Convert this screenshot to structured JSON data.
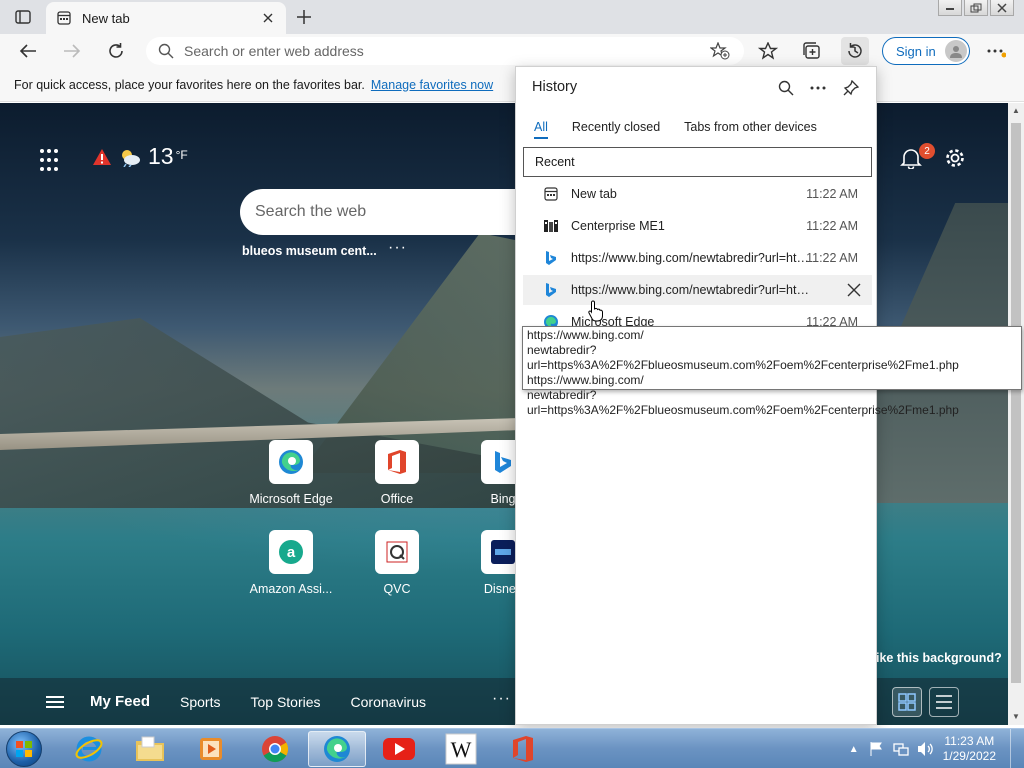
{
  "tab": {
    "title": "New tab"
  },
  "address": {
    "placeholder": "Search or enter web address"
  },
  "toolbar": {
    "signin_label": "Sign in"
  },
  "favorites_bar": {
    "message": "For quick access, place your favorites here on the favorites bar.",
    "link": "Manage favorites now"
  },
  "ntp": {
    "temperature": "13",
    "temp_unit": "°F",
    "search_placeholder": "Search the web",
    "recent_search": "blueos museum cent...",
    "notification_count": "2",
    "tiles": [
      {
        "label": "Microsoft Edge"
      },
      {
        "label": "Office"
      },
      {
        "label": "Bing"
      },
      {
        "label": "Amazon Assi..."
      },
      {
        "label": "QVC"
      },
      {
        "label": "Disney"
      }
    ],
    "background_question": "ike this background?",
    "feed": {
      "items": [
        "My Feed",
        "Sports",
        "Top Stories",
        "Coronavirus"
      ]
    }
  },
  "history": {
    "title": "History",
    "tabs": [
      "All",
      "Recently closed",
      "Tabs from other devices"
    ],
    "section": "Recent",
    "entries": [
      {
        "title": "New tab",
        "time": "11:22 AM"
      },
      {
        "title": "Centerprise ME1",
        "time": "11:22 AM"
      },
      {
        "title": "https://www.bing.com/newtabredir?url=htt...",
        "time": "11:22 AM"
      },
      {
        "title": "https://www.bing.com/newtabredir?url=htt...",
        "time": ""
      },
      {
        "title": "Microsoft Edge",
        "time": "11:22 AM"
      }
    ],
    "tooltip": [
      "https://www.bing.com/",
      "newtabredir?url=https%3A%2F%2Fblueosmuseum.com%2Foem%2Fcenterprise%2Fme1.php",
      "https://www.bing.com/",
      "newtabredir?url=https%3A%2F%2Fblueosmuseum.com%2Foem%2Fcenterprise%2Fme1.php"
    ]
  },
  "taskbar": {
    "time": "11:23 AM",
    "date": "1/29/2022"
  },
  "colors": {
    "accent": "#0f6cbd",
    "badge": "#e04e2f"
  }
}
